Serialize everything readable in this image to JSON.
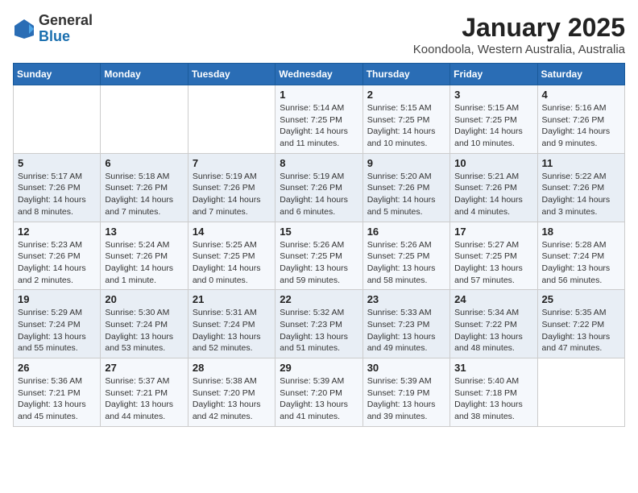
{
  "header": {
    "logo_general": "General",
    "logo_blue": "Blue",
    "title": "January 2025",
    "subtitle": "Koondoola, Western Australia, Australia"
  },
  "weekdays": [
    "Sunday",
    "Monday",
    "Tuesday",
    "Wednesday",
    "Thursday",
    "Friday",
    "Saturday"
  ],
  "weeks": [
    [
      {
        "day": "",
        "info": ""
      },
      {
        "day": "",
        "info": ""
      },
      {
        "day": "",
        "info": ""
      },
      {
        "day": "1",
        "info": "Sunrise: 5:14 AM\nSunset: 7:25 PM\nDaylight: 14 hours\nand 11 minutes."
      },
      {
        "day": "2",
        "info": "Sunrise: 5:15 AM\nSunset: 7:25 PM\nDaylight: 14 hours\nand 10 minutes."
      },
      {
        "day": "3",
        "info": "Sunrise: 5:15 AM\nSunset: 7:25 PM\nDaylight: 14 hours\nand 10 minutes."
      },
      {
        "day": "4",
        "info": "Sunrise: 5:16 AM\nSunset: 7:26 PM\nDaylight: 14 hours\nand 9 minutes."
      }
    ],
    [
      {
        "day": "5",
        "info": "Sunrise: 5:17 AM\nSunset: 7:26 PM\nDaylight: 14 hours\nand 8 minutes."
      },
      {
        "day": "6",
        "info": "Sunrise: 5:18 AM\nSunset: 7:26 PM\nDaylight: 14 hours\nand 7 minutes."
      },
      {
        "day": "7",
        "info": "Sunrise: 5:19 AM\nSunset: 7:26 PM\nDaylight: 14 hours\nand 7 minutes."
      },
      {
        "day": "8",
        "info": "Sunrise: 5:19 AM\nSunset: 7:26 PM\nDaylight: 14 hours\nand 6 minutes."
      },
      {
        "day": "9",
        "info": "Sunrise: 5:20 AM\nSunset: 7:26 PM\nDaylight: 14 hours\nand 5 minutes."
      },
      {
        "day": "10",
        "info": "Sunrise: 5:21 AM\nSunset: 7:26 PM\nDaylight: 14 hours\nand 4 minutes."
      },
      {
        "day": "11",
        "info": "Sunrise: 5:22 AM\nSunset: 7:26 PM\nDaylight: 14 hours\nand 3 minutes."
      }
    ],
    [
      {
        "day": "12",
        "info": "Sunrise: 5:23 AM\nSunset: 7:26 PM\nDaylight: 14 hours\nand 2 minutes."
      },
      {
        "day": "13",
        "info": "Sunrise: 5:24 AM\nSunset: 7:26 PM\nDaylight: 14 hours\nand 1 minute."
      },
      {
        "day": "14",
        "info": "Sunrise: 5:25 AM\nSunset: 7:25 PM\nDaylight: 14 hours\nand 0 minutes."
      },
      {
        "day": "15",
        "info": "Sunrise: 5:26 AM\nSunset: 7:25 PM\nDaylight: 13 hours\nand 59 minutes."
      },
      {
        "day": "16",
        "info": "Sunrise: 5:26 AM\nSunset: 7:25 PM\nDaylight: 13 hours\nand 58 minutes."
      },
      {
        "day": "17",
        "info": "Sunrise: 5:27 AM\nSunset: 7:25 PM\nDaylight: 13 hours\nand 57 minutes."
      },
      {
        "day": "18",
        "info": "Sunrise: 5:28 AM\nSunset: 7:24 PM\nDaylight: 13 hours\nand 56 minutes."
      }
    ],
    [
      {
        "day": "19",
        "info": "Sunrise: 5:29 AM\nSunset: 7:24 PM\nDaylight: 13 hours\nand 55 minutes."
      },
      {
        "day": "20",
        "info": "Sunrise: 5:30 AM\nSunset: 7:24 PM\nDaylight: 13 hours\nand 53 minutes."
      },
      {
        "day": "21",
        "info": "Sunrise: 5:31 AM\nSunset: 7:24 PM\nDaylight: 13 hours\nand 52 minutes."
      },
      {
        "day": "22",
        "info": "Sunrise: 5:32 AM\nSunset: 7:23 PM\nDaylight: 13 hours\nand 51 minutes."
      },
      {
        "day": "23",
        "info": "Sunrise: 5:33 AM\nSunset: 7:23 PM\nDaylight: 13 hours\nand 49 minutes."
      },
      {
        "day": "24",
        "info": "Sunrise: 5:34 AM\nSunset: 7:22 PM\nDaylight: 13 hours\nand 48 minutes."
      },
      {
        "day": "25",
        "info": "Sunrise: 5:35 AM\nSunset: 7:22 PM\nDaylight: 13 hours\nand 47 minutes."
      }
    ],
    [
      {
        "day": "26",
        "info": "Sunrise: 5:36 AM\nSunset: 7:21 PM\nDaylight: 13 hours\nand 45 minutes."
      },
      {
        "day": "27",
        "info": "Sunrise: 5:37 AM\nSunset: 7:21 PM\nDaylight: 13 hours\nand 44 minutes."
      },
      {
        "day": "28",
        "info": "Sunrise: 5:38 AM\nSunset: 7:20 PM\nDaylight: 13 hours\nand 42 minutes."
      },
      {
        "day": "29",
        "info": "Sunrise: 5:39 AM\nSunset: 7:20 PM\nDaylight: 13 hours\nand 41 minutes."
      },
      {
        "day": "30",
        "info": "Sunrise: 5:39 AM\nSunset: 7:19 PM\nDaylight: 13 hours\nand 39 minutes."
      },
      {
        "day": "31",
        "info": "Sunrise: 5:40 AM\nSunset: 7:18 PM\nDaylight: 13 hours\nand 38 minutes."
      },
      {
        "day": "",
        "info": ""
      }
    ]
  ]
}
